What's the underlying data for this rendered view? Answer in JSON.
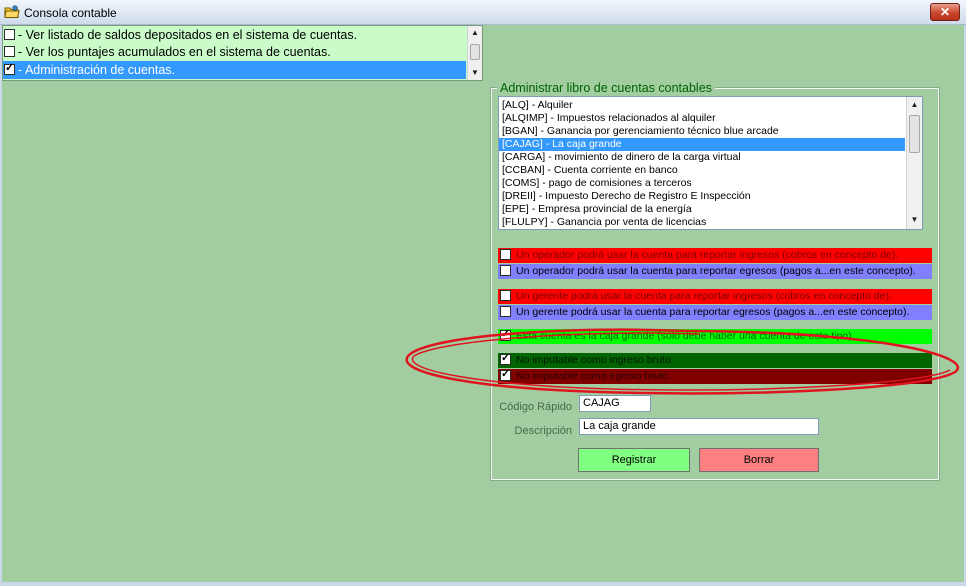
{
  "window": {
    "title": "Consola contable",
    "close_label": "✕"
  },
  "menu": {
    "items": [
      {
        "label": "- Ver listado de saldos depositados en el sistema de cuentas.",
        "checked": false,
        "selected": false
      },
      {
        "label": "- Ver los puntajes acumulados en el sistema de cuentas.",
        "checked": false,
        "selected": false
      },
      {
        "label": "- Administración de cuentas.",
        "checked": true,
        "selected": true
      }
    ]
  },
  "group": {
    "title": "Administrar libro de cuentas contables",
    "accounts": [
      {
        "label": "[ALQ] - Alquiler",
        "selected": false
      },
      {
        "label": "[ALQIMP] - Impuestos relacionados al alquiler",
        "selected": false
      },
      {
        "label": "[BGAN] - Ganancia por gerenciamiento técnico blue arcade",
        "selected": false
      },
      {
        "label": "[CAJAG] - La caja grande",
        "selected": true
      },
      {
        "label": "[CARGA] - movimiento de dinero de la carga virtual",
        "selected": false
      },
      {
        "label": "[CCBAN] - Cuenta corriente en banco",
        "selected": false
      },
      {
        "label": "[COMS] - pago de comisiones a terceros",
        "selected": false
      },
      {
        "label": "[DREII] - Impuesto Derecho de Registro E Inspección",
        "selected": false
      },
      {
        "label": "[EPE] - Empresa provincial de la energía",
        "selected": false
      },
      {
        "label": "[FLULPY] - Ganancia por venta de licencias",
        "selected": false
      }
    ],
    "options": [
      {
        "label": "Un operador podrá usar la cuenta para reportar ingresos (cobros en concepto de).",
        "checked": false,
        "bg": "#ff0000",
        "fg": "#7a0000"
      },
      {
        "label": "Un operador podrá usar la cuenta para reportar egresos (pagos a...en este concepto).",
        "checked": false,
        "bg": "#8080ff",
        "fg": "#000000"
      },
      {
        "label": "Un gerente podrá usar la cuenta para reportar ingresos (cobros en concepto de).",
        "checked": false,
        "bg": "#ff0000",
        "fg": "#7a0000"
      },
      {
        "label": "Un gerente podrá usar la cuenta para reportar egresos (pagos a...en este concepto).",
        "checked": false,
        "bg": "#8080ff",
        "fg": "#000000"
      },
      {
        "label": "Esta cuenta es la caja grande (solo debe haber una cuenta de este tipo).",
        "checked": true,
        "bg": "#00ff00",
        "fg": "#006400"
      },
      {
        "label": "No imputable como ingreso bruto.",
        "checked": true,
        "bg": "#006400",
        "fg": "#001800"
      },
      {
        "label": "No imputable como egreso bruto.",
        "checked": true,
        "bg": "#800000",
        "fg": "#2a0000"
      }
    ],
    "codigo_label": "Código Rápido",
    "codigo_value": "CAJAG",
    "descripcion_label": "Descripción",
    "descripcion_value": "La caja grande",
    "registrar_label": "Registrar",
    "borrar_label": "Borrar"
  },
  "colors": {
    "client_bg": "#a1cda0",
    "menu_bg": "#c9fcc9",
    "selection": "#3399ff",
    "annotation": "#e0141e",
    "registrar_bg": "#80ff80",
    "borrar_bg": "#ff8080"
  }
}
